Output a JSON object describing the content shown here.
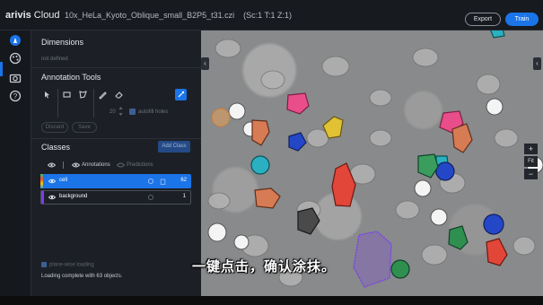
{
  "app": {
    "brand_bold": "arivis",
    "brand_rest": " Cloud",
    "filename": "10x_HeLa_Kyoto_Oblique_small_B2P5_t31.czi",
    "dims": "(Sc:1 T:1 Z:1)"
  },
  "topbar": {
    "export_label": "Export",
    "train_label": "Train"
  },
  "rail": {
    "items": [
      "annotate-icon",
      "palette-icon",
      "camera-icon",
      "help-icon"
    ]
  },
  "dimensions": {
    "title": "Dimensions",
    "value": "not defined"
  },
  "annotation_tools": {
    "title": "Annotation Tools",
    "brush_size": "20",
    "autofill_label": "autofill holes",
    "discard_label": "Discard",
    "save_label": "Save"
  },
  "classes": {
    "title": "Classes",
    "add_label": "Add Class",
    "annotations_label": "Annotations",
    "predictions_label": "Predictions",
    "items": [
      {
        "label": "cell",
        "count": "62",
        "color": "#1b74e8"
      },
      {
        "label": "background",
        "count": "1",
        "color": "#7a3cf0"
      }
    ]
  },
  "footer": {
    "plane_wise": "plane-wise loading",
    "status": "Loading complete with 63 objects."
  },
  "viewer": {
    "fit_label": "Fit",
    "zoom_in": "+",
    "zoom_out": "−"
  },
  "caption": "一键点击，确认涂抹。",
  "colors": {
    "accent": "#1b74e8",
    "background_class": "#7a3cf0"
  }
}
